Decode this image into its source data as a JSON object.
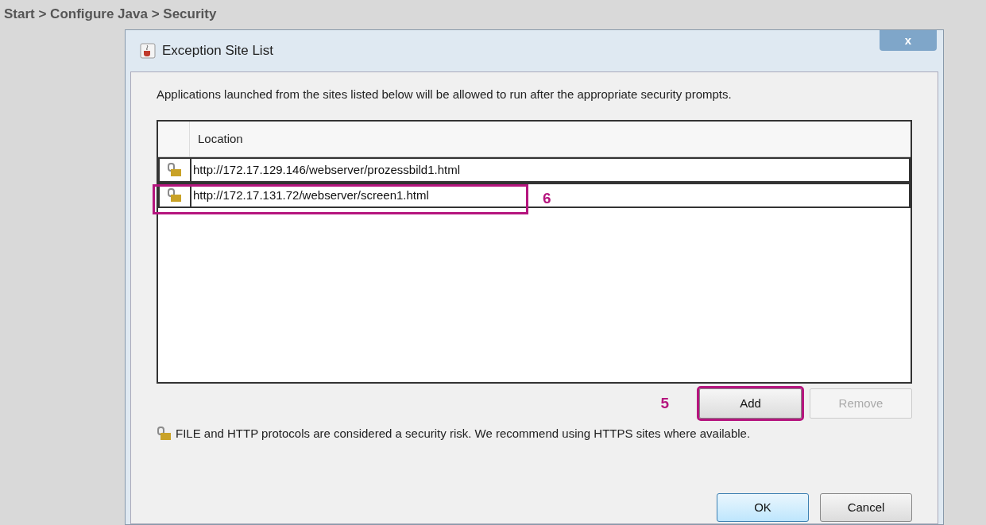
{
  "breadcrumb": "Start > Configure Java > Security",
  "dialog": {
    "title": "Exception Site List",
    "close": "x",
    "description": "Applications launched from the sites listed below will be allowed to run after the appropriate security prompts.",
    "table": {
      "columns": [
        "Location"
      ],
      "rows": [
        {
          "url": "http://172.17.129.146/webserver/prozessbild1.html",
          "highlighted": false
        },
        {
          "url": "http://172.17.131.72/webserver/screen1.html",
          "highlighted": true,
          "callout": "6"
        }
      ]
    },
    "list_buttons": [
      {
        "label": "Add",
        "disabled": false,
        "highlighted": true,
        "callout": "5"
      },
      {
        "label": "Remove",
        "disabled": true,
        "highlighted": false
      }
    ],
    "warning": "FILE and HTTP protocols are considered a security risk.  We recommend using HTTPS sites where available.",
    "footer_buttons": [
      {
        "label": "OK",
        "default": true
      },
      {
        "label": "Cancel",
        "default": false
      }
    ]
  }
}
